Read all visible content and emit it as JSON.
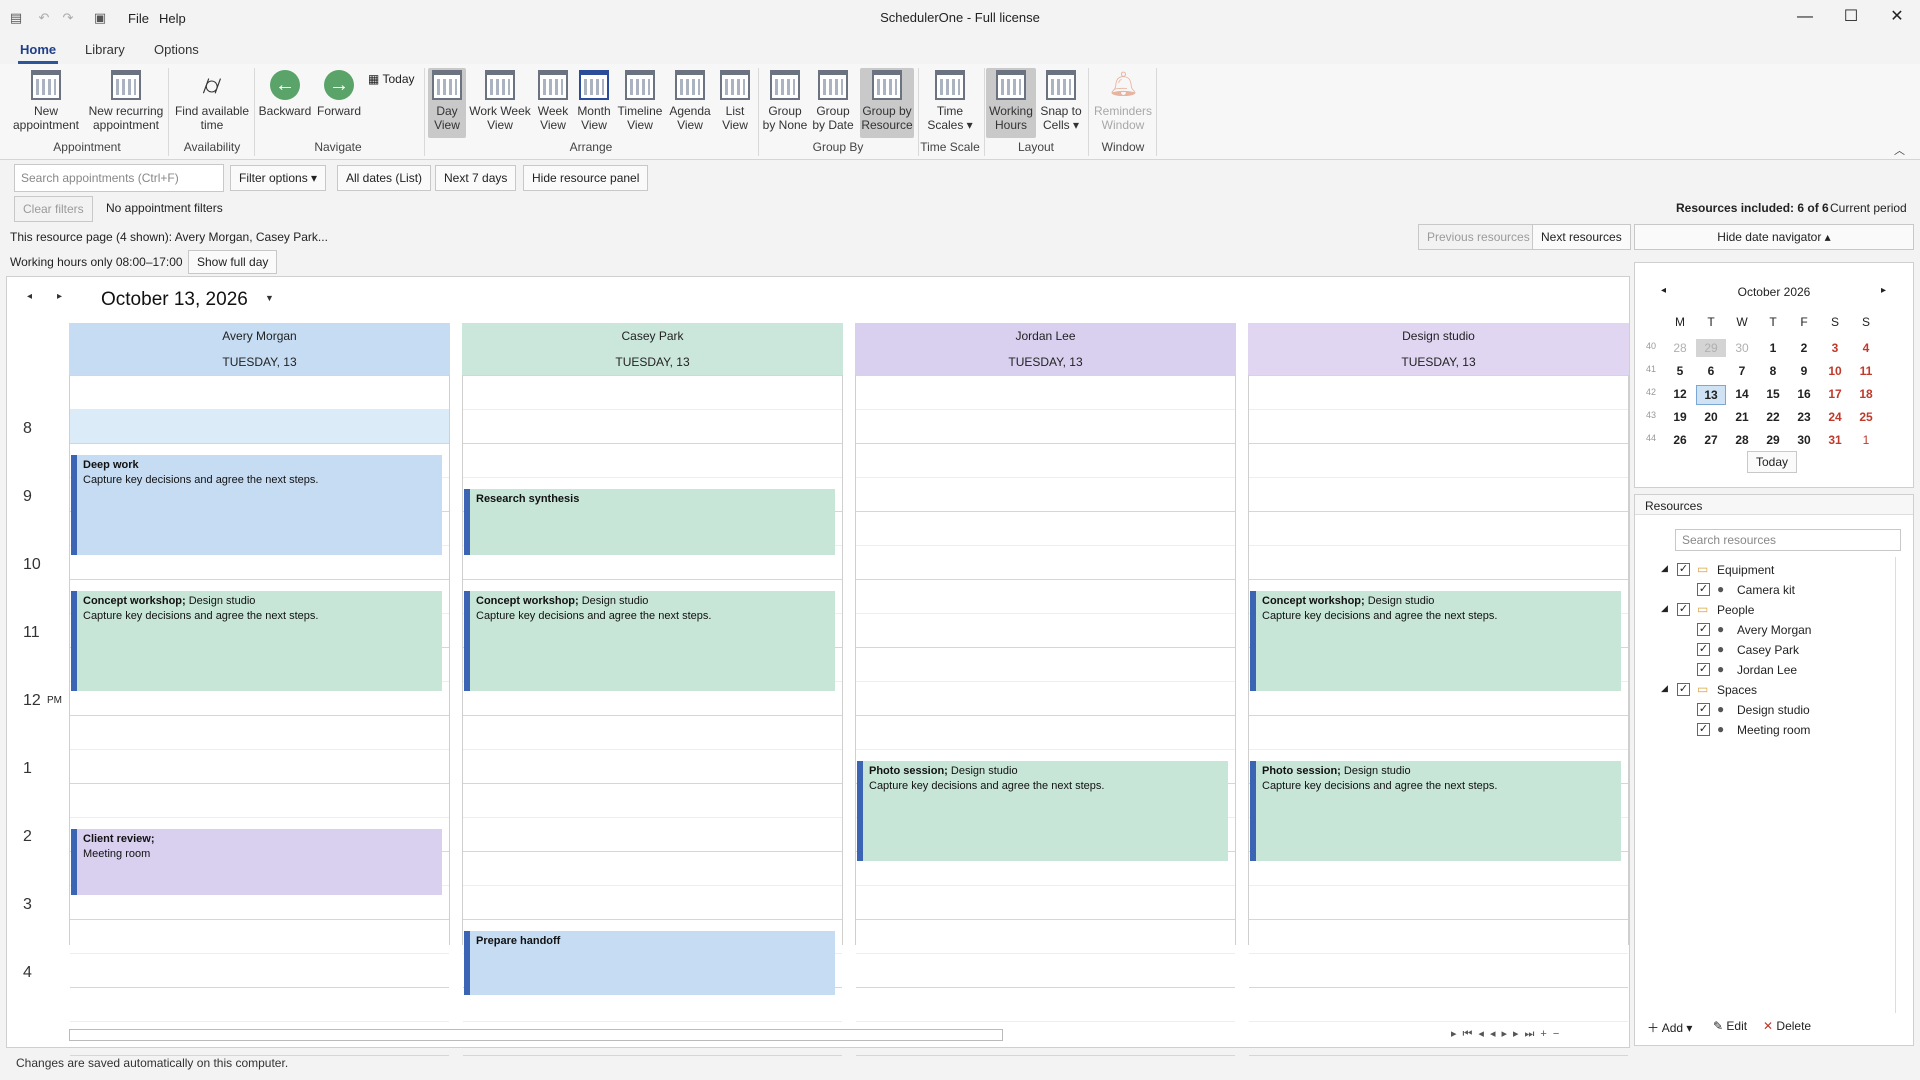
{
  "app": {
    "title": "SchedulerOne - Full license",
    "menu": [
      "File",
      "Help"
    ]
  },
  "tabs": [
    "Home",
    "Library",
    "Options"
  ],
  "ribbon": {
    "groups": {
      "appointment": "Appointment",
      "availability": "Availability",
      "navigate": "Navigate",
      "arrange": "Arrange",
      "groupby": "Group By",
      "timescale": "Time Scale",
      "layout": "Layout",
      "window": "Window"
    },
    "new_appointment": [
      "New",
      "appointment"
    ],
    "new_recurring": [
      "New recurring",
      "appointment"
    ],
    "find_time": [
      "Find available",
      "time"
    ],
    "backward": "Backward",
    "forward": "Forward",
    "today": "Today",
    "day_view": [
      "Day",
      "View"
    ],
    "work_week_view": [
      "Work Week",
      "View"
    ],
    "week_view": [
      "Week",
      "View"
    ],
    "month_view": [
      "Month",
      "View"
    ],
    "timeline_view": [
      "Timeline",
      "View"
    ],
    "agenda_view": [
      "Agenda",
      "View"
    ],
    "list_view": [
      "List",
      "View"
    ],
    "group_none": [
      "Group",
      "by None"
    ],
    "group_date": [
      "Group",
      "by Date"
    ],
    "group_resource": [
      "Group by",
      "Resource"
    ],
    "time_scales": [
      "Time",
      "Scales ▾"
    ],
    "working_hours": [
      "Working",
      "Hours"
    ],
    "snap_cells": [
      "Snap to",
      "Cells ▾"
    ],
    "reminders": [
      "Reminders",
      "Window"
    ]
  },
  "toolbar": {
    "search_placeholder": "Search appointments (Ctrl+F)",
    "filter_options": "Filter options ▾",
    "all_dates": "All dates (List)",
    "next7": "Next 7 days",
    "hide_resource_panel": "Hide resource panel",
    "clear_filters": "Clear filters",
    "no_filters": "No appointment filters",
    "resources_included": "Resources included: 6 of 6",
    "current_period": "Current period",
    "resource_page": "This resource page (4 shown): Avery Morgan, Casey Park...",
    "prev_resources": "Previous resources",
    "next_resources": "Next resources",
    "hide_date_nav": "Hide date navigator ▴",
    "working_hours_note": "Working hours only 08:00–17:00",
    "show_full_day": "Show full day"
  },
  "scheduler": {
    "date_title": "October 13, 2026",
    "resources": [
      {
        "name": "Avery Morgan",
        "date": "TUESDAY, 13",
        "color": "#c5dcf3"
      },
      {
        "name": "Casey Park",
        "date": "TUESDAY, 13",
        "color": "#cbe7dc"
      },
      {
        "name": "Jordan Lee",
        "date": "TUESDAY, 13",
        "color": "#d9d0f0"
      },
      {
        "name": "Design studio",
        "date": "TUESDAY, 13",
        "color": "#e0d6f2"
      }
    ],
    "hours": [
      "8",
      "9",
      "10",
      "11",
      "12",
      "1",
      "2",
      "3",
      "4"
    ],
    "pm_label": "PM",
    "appointments": [
      {
        "title": "Deep work",
        "location": "",
        "note": "Capture key decisions and agree the next steps."
      },
      {
        "title": "Concept workshop;",
        "location": "Design studio",
        "note": "Capture key decisions and agree the next steps."
      },
      {
        "title": "Client review;",
        "location": "Meeting room",
        "note": ""
      },
      {
        "title": "Research synthesis",
        "location": "",
        "note": ""
      },
      {
        "title": "Concept workshop;",
        "location": "Design studio",
        "note": "Capture key decisions and agree the next steps."
      },
      {
        "title": "Prepare handoff",
        "location": "",
        "note": ""
      },
      {
        "title": "Photo session;",
        "location": "Design studio",
        "note": "Capture key decisions and agree the next steps."
      },
      {
        "title": "Concept workshop;",
        "location": "Design studio",
        "note": "Capture key decisions and agree the next steps."
      },
      {
        "title": "Photo session;",
        "location": "Design studio",
        "note": "Capture key decisions and agree the next steps."
      }
    ]
  },
  "mini_calendar": {
    "month": "October 2026",
    "weekdays": [
      "M",
      "T",
      "W",
      "T",
      "F",
      "S",
      "S"
    ],
    "weeks": [
      {
        "wk": "40",
        "days": [
          "28",
          "29",
          "30",
          "1",
          "2",
          "3",
          "4"
        ]
      },
      {
        "wk": "41",
        "days": [
          "5",
          "6",
          "7",
          "8",
          "9",
          "10",
          "11"
        ]
      },
      {
        "wk": "42",
        "days": [
          "12",
          "13",
          "14",
          "15",
          "16",
          "17",
          "18"
        ]
      },
      {
        "wk": "43",
        "days": [
          "19",
          "20",
          "21",
          "22",
          "23",
          "24",
          "25"
        ]
      },
      {
        "wk": "44",
        "days": [
          "26",
          "27",
          "28",
          "29",
          "30",
          "31",
          "1"
        ]
      }
    ],
    "today_label": "Today"
  },
  "resources_panel": {
    "title": "Resources",
    "search_placeholder": "Search resources",
    "tree": [
      {
        "label": "Equipment",
        "type": "folder",
        "level": 0
      },
      {
        "label": "Camera kit",
        "type": "person",
        "level": 1
      },
      {
        "label": "People",
        "type": "folder",
        "level": 0
      },
      {
        "label": "Avery Morgan",
        "type": "person",
        "level": 1
      },
      {
        "label": "Casey Park",
        "type": "person",
        "level": 1
      },
      {
        "label": "Jordan Lee",
        "type": "person",
        "level": 1
      },
      {
        "label": "Spaces",
        "type": "folder",
        "level": 0
      },
      {
        "label": "Design studio",
        "type": "person",
        "level": 1
      },
      {
        "label": "Meeting room",
        "type": "person",
        "level": 1
      }
    ],
    "add": "Add",
    "edit": "Edit",
    "delete": "Delete"
  },
  "status": "Changes are saved automatically on this computer."
}
